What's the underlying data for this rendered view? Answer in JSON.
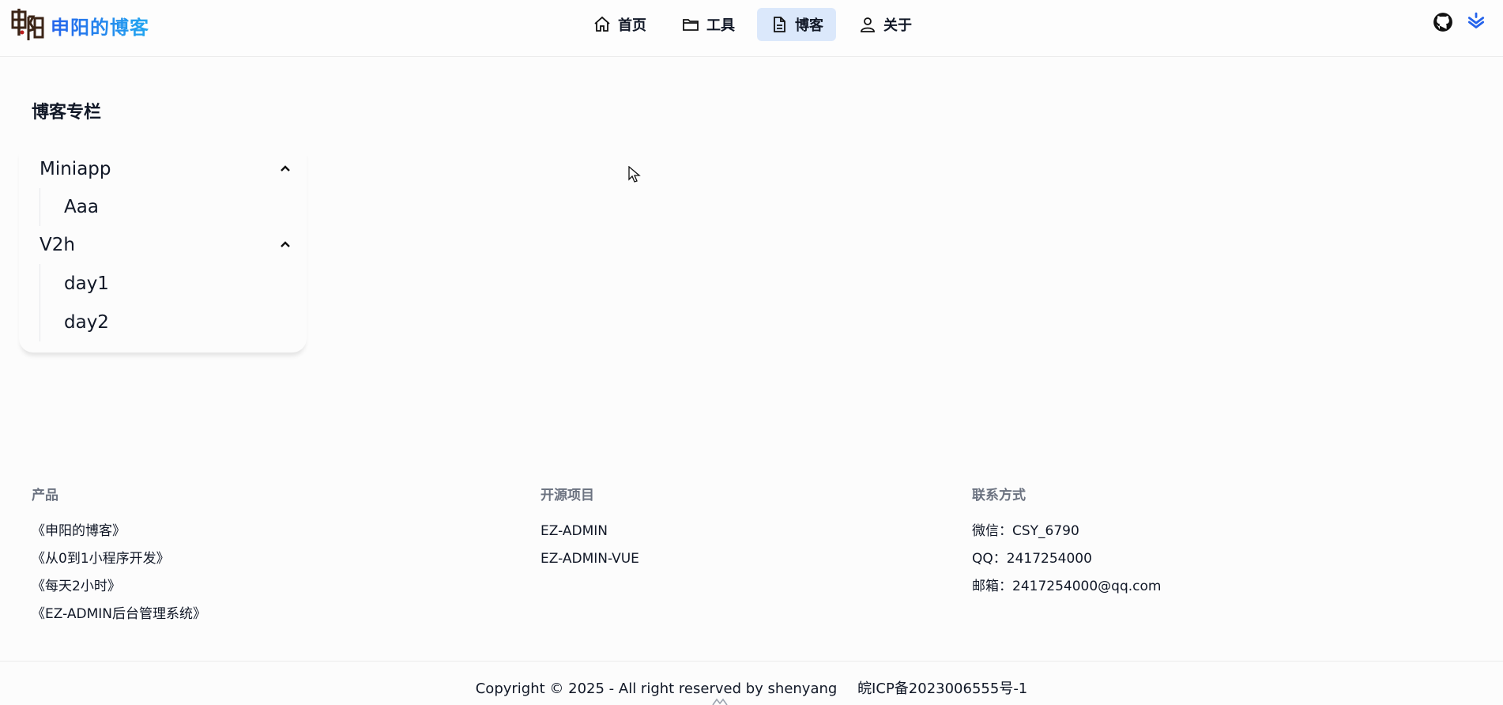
{
  "brand": {
    "title": "申阳的博客",
    "logo_text": "申阳"
  },
  "nav": [
    {
      "label": "首页",
      "icon": "home-icon"
    },
    {
      "label": "工具",
      "icon": "folder-icon"
    },
    {
      "label": "博客",
      "icon": "document-icon",
      "active": true
    },
    {
      "label": "关于",
      "icon": "user-icon"
    }
  ],
  "header_actions": [
    "github-icon",
    "layers-icon"
  ],
  "sidebar": {
    "title": "博客专栏",
    "groups": [
      {
        "label": "Miniapp",
        "items": [
          "Aaa"
        ]
      },
      {
        "label": "V2h",
        "items": [
          "day1",
          "day2"
        ]
      }
    ]
  },
  "footer": {
    "products": {
      "title": "产品",
      "items": [
        "《申阳的博客》",
        "《从0到1小程序开发》",
        "《每天2小时》",
        "《EZ-ADMIN后台管理系统》"
      ]
    },
    "open_source": {
      "title": "开源项目",
      "items": [
        "EZ-ADMIN",
        "EZ-ADMIN-VUE"
      ]
    },
    "contact": {
      "title": "联系方式",
      "items": [
        "微信：CSY_6790",
        "QQ：2417254000",
        "邮箱：2417254000@qq.com"
      ]
    },
    "copyright": "Copyright © 2025 - All right reserved by shenyang",
    "icp": "皖ICP备2023006555号-1"
  },
  "colors": {
    "accent": "#2563eb",
    "active_nav_bg": "#dbe8fb"
  }
}
